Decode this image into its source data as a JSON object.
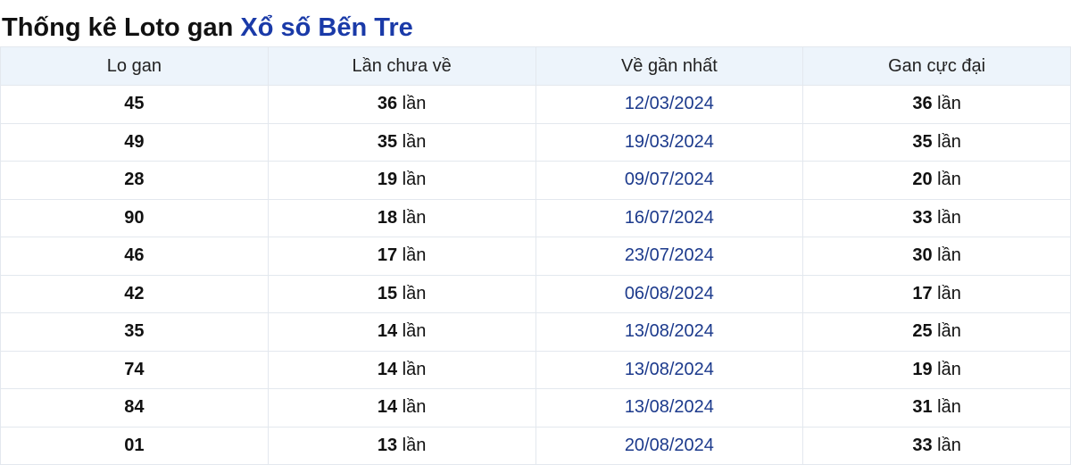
{
  "title": {
    "prefix": "Thống kê Loto gan",
    "link": "Xổ số Bến Tre"
  },
  "table": {
    "headers": [
      "Lo gan",
      "Lần chưa về",
      "Về gần nhất",
      "Gan cực đại"
    ],
    "unit": "lần",
    "rows": [
      {
        "lo": "45",
        "chua_ve": "36",
        "gan_nhat": "12/03/2024",
        "cuc_dai": "36"
      },
      {
        "lo": "49",
        "chua_ve": "35",
        "gan_nhat": "19/03/2024",
        "cuc_dai": "35"
      },
      {
        "lo": "28",
        "chua_ve": "19",
        "gan_nhat": "09/07/2024",
        "cuc_dai": "20"
      },
      {
        "lo": "90",
        "chua_ve": "18",
        "gan_nhat": "16/07/2024",
        "cuc_dai": "33"
      },
      {
        "lo": "46",
        "chua_ve": "17",
        "gan_nhat": "23/07/2024",
        "cuc_dai": "30"
      },
      {
        "lo": "42",
        "chua_ve": "15",
        "gan_nhat": "06/08/2024",
        "cuc_dai": "17"
      },
      {
        "lo": "35",
        "chua_ve": "14",
        "gan_nhat": "13/08/2024",
        "cuc_dai": "25"
      },
      {
        "lo": "74",
        "chua_ve": "14",
        "gan_nhat": "13/08/2024",
        "cuc_dai": "19"
      },
      {
        "lo": "84",
        "chua_ve": "14",
        "gan_nhat": "13/08/2024",
        "cuc_dai": "31"
      },
      {
        "lo": "01",
        "chua_ve": "13",
        "gan_nhat": "20/08/2024",
        "cuc_dai": "33"
      }
    ]
  },
  "colors": {
    "link": "#1a3aa8",
    "date": "#1c3a8c",
    "header_bg": "#edf4fb",
    "border": "#e3e8ee"
  }
}
